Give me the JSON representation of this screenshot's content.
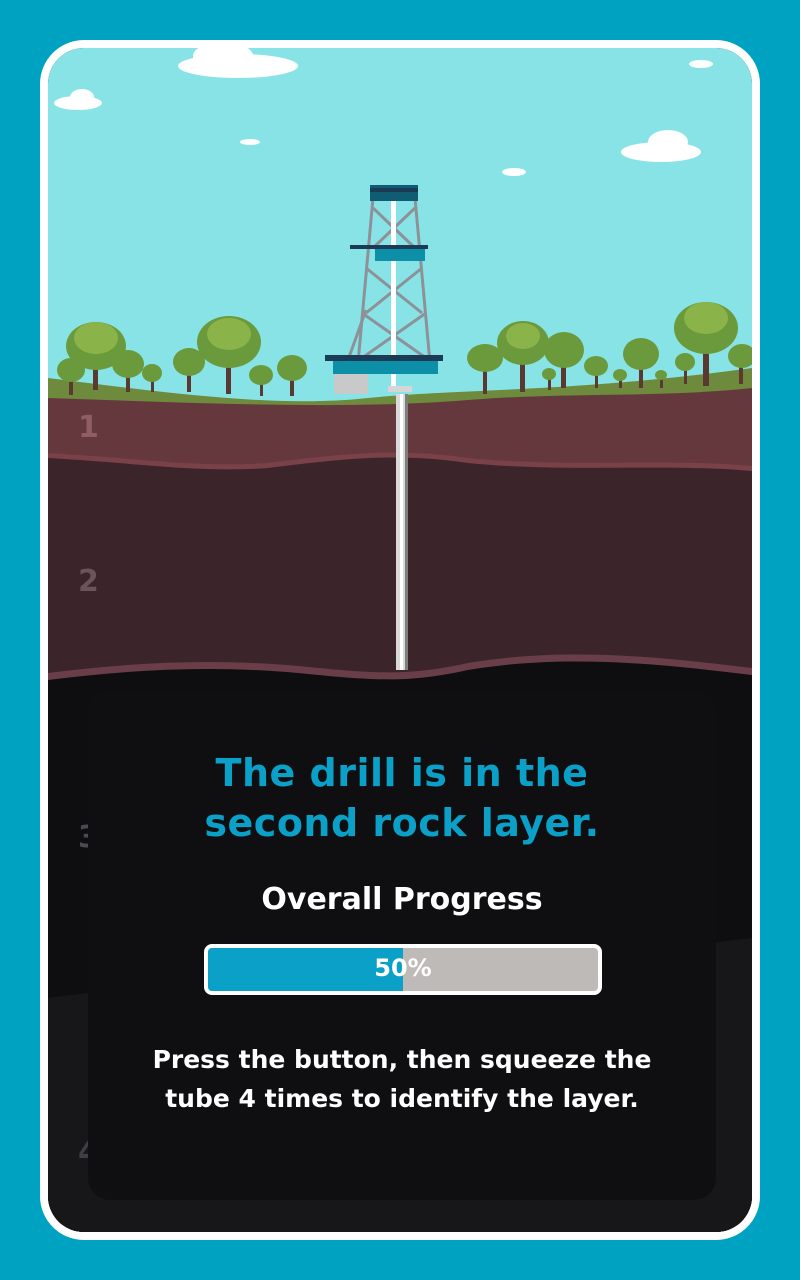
{
  "layers": [
    "1",
    "2",
    "3",
    "4"
  ],
  "panel": {
    "title": "The drill is in the second rock layer.",
    "progress_label": "Overall Progress",
    "progress_percent": 50,
    "progress_text": "50%",
    "instruction": "Press the button, then squeeze the tube 4 times to identify the layer."
  },
  "colors": {
    "background": "#00a2c2",
    "sky": "#88e3e6",
    "grass": "#6e8a3c",
    "layer1": "#65383e",
    "layer2": "#3b252b",
    "layer3": "#0e0d10",
    "accent": "#0aa0c8",
    "progress_track": "#bdbab8"
  },
  "icons": [
    "cloud-icon",
    "tree-icon",
    "drilling-rig-icon",
    "drill-pipe-icon"
  ]
}
